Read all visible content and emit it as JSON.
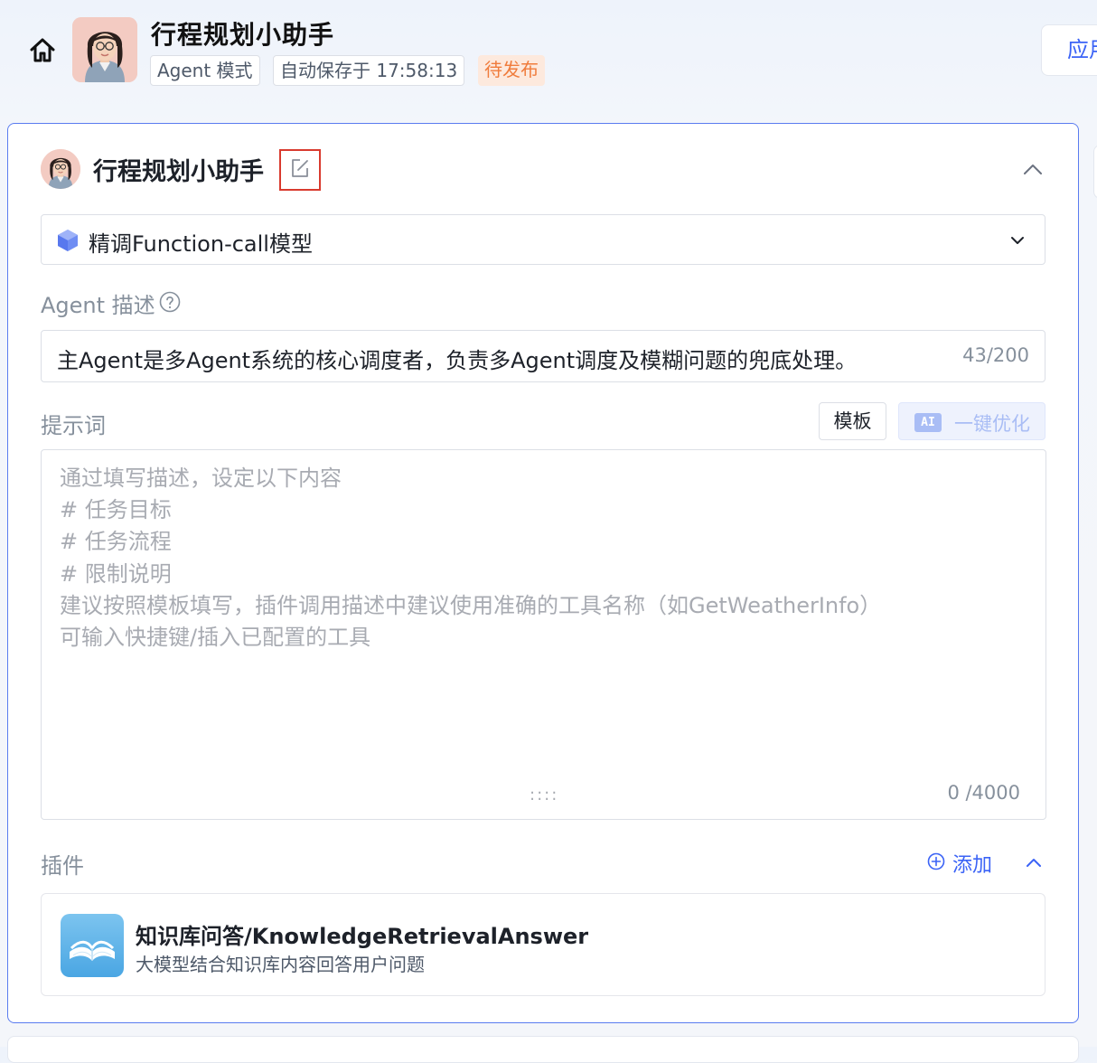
{
  "header": {
    "app_title": "行程规划小助手",
    "mode_tag": "Agent 模式",
    "saved_tag": "自动保存于 17:58:13",
    "status_tag": "待发布",
    "apply_button": "应用"
  },
  "agent": {
    "name": "行程规划小助手"
  },
  "model": {
    "selected": "精调Function-call模型"
  },
  "description": {
    "label": "Agent 描述",
    "value": "主Agent是多Agent系统的核心调度者，负责多Agent调度及模糊问题的兜底处理。",
    "count": "43/200"
  },
  "prompt": {
    "label": "提示词",
    "template_button": "模板",
    "ai_badge": "AI",
    "optimize_button": "一键优化",
    "placeholder_lines": [
      "通过填写描述，设定以下内容",
      "# 任务目标",
      "# 任务流程",
      "# 限制说明",
      "建议按照模板填写，插件调用描述中建议使用准确的工具名称（如GetWeatherInfo）",
      "可输入快捷键/插入已配置的工具"
    ],
    "resize_handle": "::::",
    "count": "0 /4000"
  },
  "plugins": {
    "label": "插件",
    "add_button": "添加",
    "items": [
      {
        "name": "知识库问答/KnowledgeRetrievalAnswer",
        "description": "大模型结合知识库内容回答用户问题"
      }
    ]
  },
  "colors": {
    "accent": "#3b63f6",
    "card_border": "#5a7cf0",
    "status_bg": "#fde9dd",
    "status_text": "#f07c3c",
    "edit_highlight": "#d93a2e"
  },
  "icons": [
    "home-icon",
    "edit-icon",
    "chevron-up-icon",
    "cube-icon",
    "chevron-down-icon",
    "help-icon",
    "add-circle-icon",
    "book-icon"
  ]
}
